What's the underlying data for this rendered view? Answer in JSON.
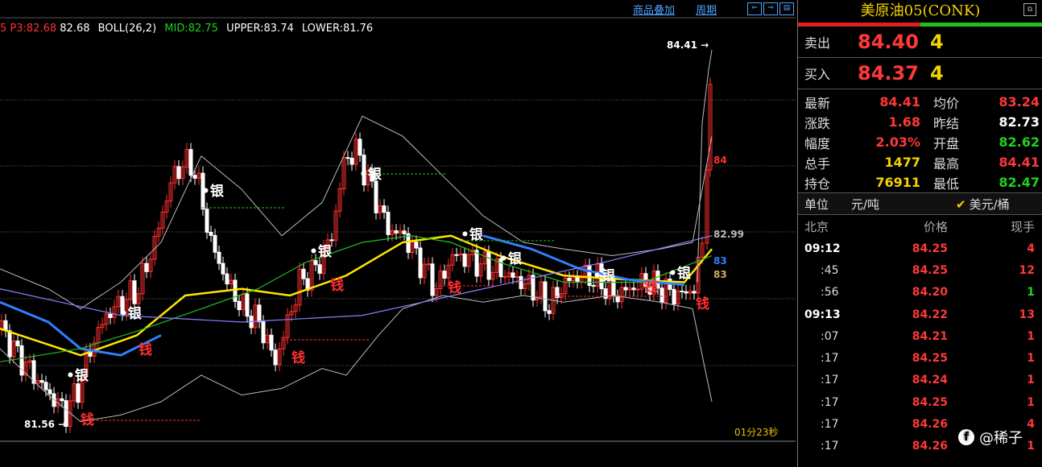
{
  "toplinks": {
    "overlay": "商品叠加",
    "period": "周期"
  },
  "indicator": {
    "p_prefix": "5",
    "p3": "P3:82.68",
    "p3_val": "82.68",
    "boll": "BOLL(26,2)",
    "mid": "MID:82.75",
    "upper": "UPPER:83.74",
    "lower": "LOWER:81.76"
  },
  "chart": {
    "price_high_label": "84.41",
    "price_low_label": "81.56",
    "right_labels": {
      "r84": "84",
      "r8299": "82.99",
      "r83a": "83",
      "r83b": "83"
    },
    "timer": "01分23秒",
    "marker_yin": "•银",
    "marker_qian": "钱",
    "colors": {
      "up": "#ff3030",
      "down": "#ffffff",
      "mid": "#ffe600",
      "blue": "#2f7fff",
      "green": "#1fbf1f",
      "band": "#bbbbbb",
      "grid": "#666666"
    }
  },
  "panel": {
    "title": "美原油05(CONK)",
    "sell_label": "卖出",
    "sell_price": "84.40",
    "sell_qty": "4",
    "buy_label": "买入",
    "buy_price": "84.37",
    "buy_qty": "4",
    "stats": [
      {
        "k": "最新",
        "v": "84.41",
        "vc": "#ff3838",
        "k2": "均价",
        "v2": "83.24",
        "v2c": "#ff3838"
      },
      {
        "k": "涨跌",
        "v": "1.68",
        "vc": "#ff3838",
        "k2": "昨结",
        "v2": "82.73",
        "v2c": "#ffffff"
      },
      {
        "k": "幅度",
        "v": "2.03%",
        "vc": "#ff3838",
        "k2": "开盘",
        "v2": "82.62",
        "v2c": "#20d020"
      },
      {
        "k": "总手",
        "v": "1477",
        "vc": "#f2d200",
        "k2": "最高",
        "v2": "84.41",
        "v2c": "#ff3838"
      },
      {
        "k": "持仓",
        "v": "76911",
        "vc": "#f2d200",
        "k2": "最低",
        "v2": "82.47",
        "v2c": "#20d020"
      }
    ],
    "unit_label": "单位",
    "unit_value": "元/吨",
    "unit_alt": "美元/桶",
    "table_head": {
      "time": "北京",
      "price": "价格",
      "qty": "现手"
    },
    "trades": [
      {
        "time": "09:12",
        "sub": false,
        "price": "84.25",
        "qty": "4",
        "qc": "#ff3838"
      },
      {
        "time": ":45",
        "sub": true,
        "price": "84.25",
        "qty": "12",
        "qc": "#ff3838"
      },
      {
        "time": ":56",
        "sub": true,
        "price": "84.20",
        "qty": "1",
        "qc": "#20d020"
      },
      {
        "time": "09:13",
        "sub": false,
        "price": "84.22",
        "qty": "13",
        "qc": "#ff3838"
      },
      {
        "time": ":07",
        "sub": true,
        "price": "84.21",
        "qty": "1",
        "qc": "#ff3838"
      },
      {
        "time": ":17",
        "sub": true,
        "price": "84.25",
        "qty": "1",
        "qc": "#ff3838"
      },
      {
        "time": ":17",
        "sub": true,
        "price": "84.24",
        "qty": "1",
        "qc": "#ff3838"
      },
      {
        "time": ":17",
        "sub": true,
        "price": "84.25",
        "qty": "1",
        "qc": "#ff3838"
      },
      {
        "time": ":17",
        "sub": true,
        "price": "84.26",
        "qty": "4",
        "qc": "#ff3838"
      },
      {
        "time": ":17",
        "sub": true,
        "price": "84.26",
        "qty": "1",
        "qc": "#ff3838"
      }
    ]
  },
  "watermark": "@稀子"
}
